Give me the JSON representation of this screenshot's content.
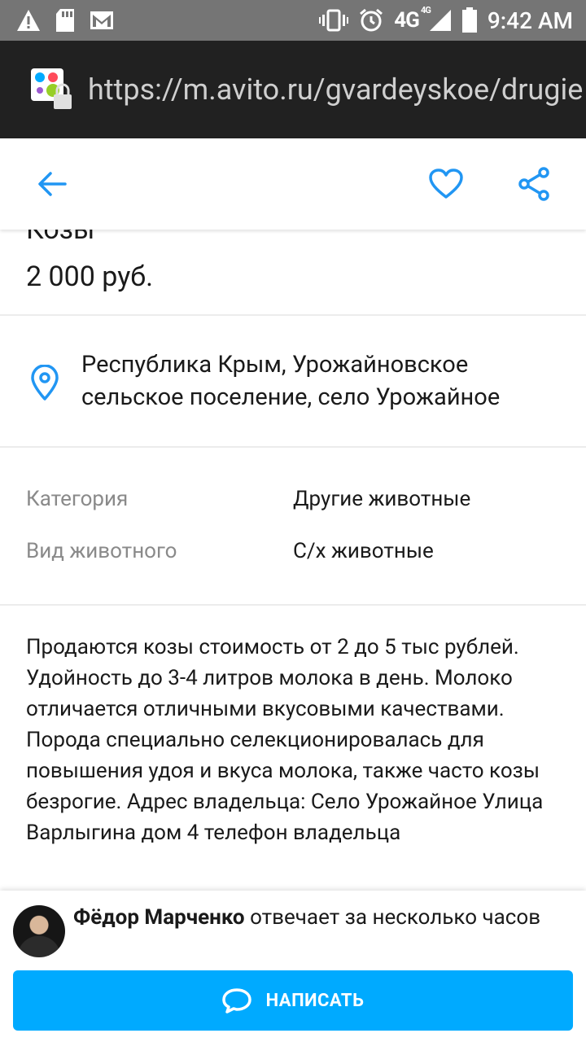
{
  "status_bar": {
    "time": "9:42 AM",
    "network": "4G",
    "network_sup": "4G",
    "icons": [
      "warning-icon",
      "sd-card-icon",
      "gmail-icon",
      "vibrate-icon",
      "alarm-icon",
      "signal-icon",
      "battery-icon"
    ]
  },
  "browser": {
    "url": "https://m.avito.ru/gvardeyskoe/drugie"
  },
  "app_bar": {
    "icons": [
      "back-arrow-icon",
      "heart-icon",
      "share-icon"
    ],
    "accent_color": "#2196f3"
  },
  "listing": {
    "title_clipped": "Козы",
    "price": "2 000 руб.",
    "location": "Республика Крым, Урожайновское сельское поселение, село Урожайное",
    "params": [
      {
        "label": "Категория",
        "value": "Другие животные"
      },
      {
        "label": "Вид животного",
        "value": "С/х животные"
      }
    ],
    "description": "Продаются козы стоимость от 2 до 5 тыс рублей. Удойность до 3-4 литров молока в день. Молоко отличается отличными вкусовыми качествами. Порода специально селекционировалась для повышения удоя и вкуса молока, также часто козы безрогие. Адрес владельца: Село Урожайное Улица Варлыгина дом 4 телефон владельца"
  },
  "seller": {
    "name": "Фёдор Марченко",
    "response_text": "отвечает за несколько часов"
  },
  "cta": {
    "label": "НАПИСАТЬ",
    "color": "#00aaff"
  }
}
